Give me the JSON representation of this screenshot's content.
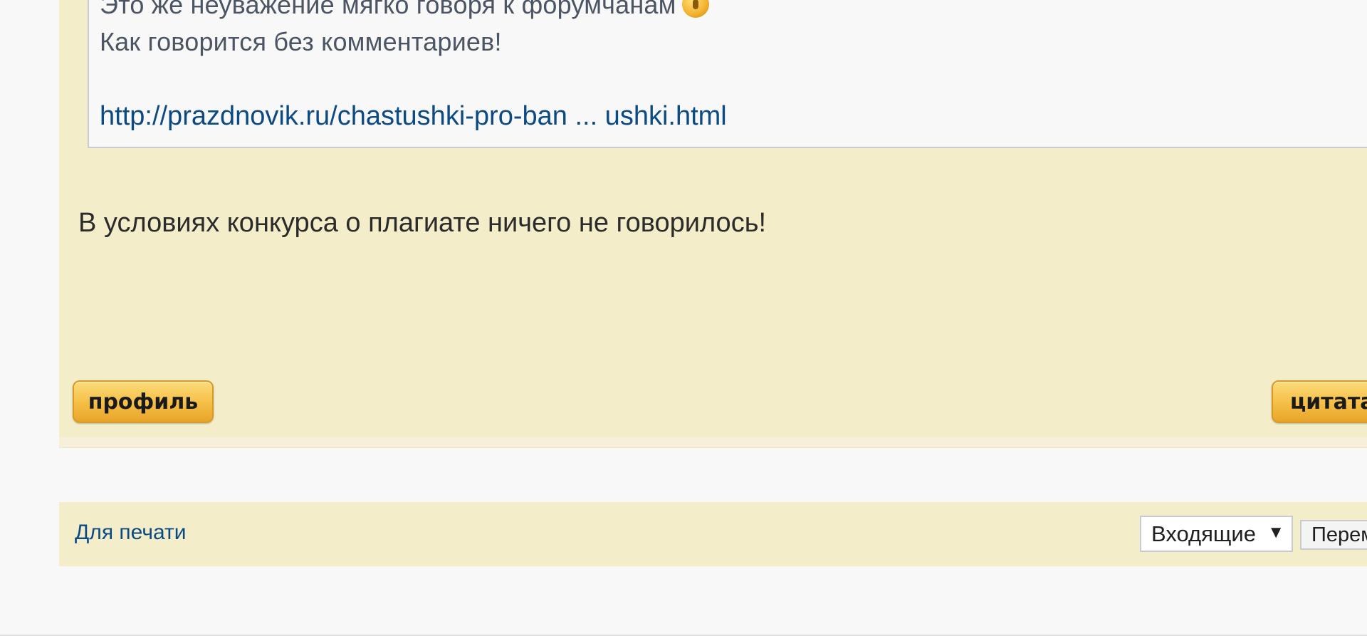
{
  "quote": {
    "line1": "Это же неуважение мягко говоря к форумчанам",
    "line1_smiley_icon": "wink-smiley-icon",
    "line2": "Как говорится без комментариев!",
    "link_text": "http://prazdnovik.ru/chastushki-pro-ban ... ushki.html"
  },
  "post": {
    "text": "В условиях конкурса о плагиате ничего не говорилось!"
  },
  "buttons": {
    "profile_label": "профиль",
    "quote_label": "цитата"
  },
  "footer": {
    "print_link": "Для печати",
    "folder_select_value": "Входящие",
    "move_button_label": "Переместить"
  },
  "colors": {
    "panel_bg": "#f3edc9",
    "link": "#0c4a83",
    "button_gold": "#f5be45"
  }
}
